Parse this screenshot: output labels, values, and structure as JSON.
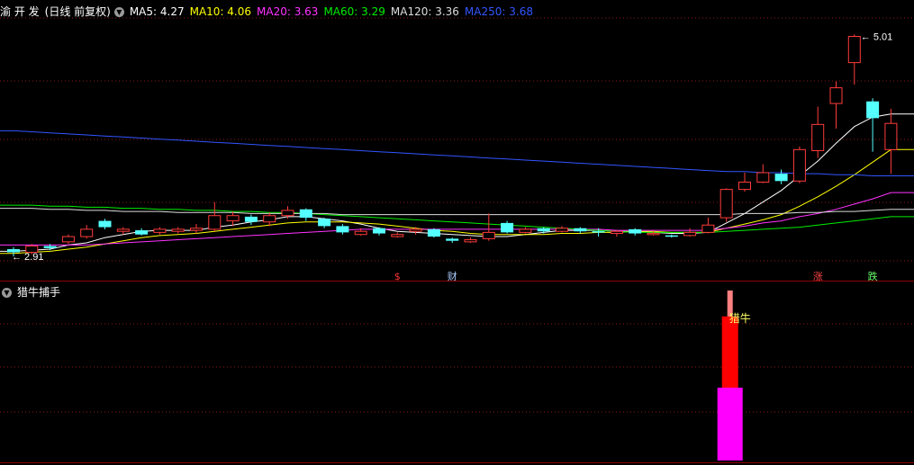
{
  "main_header": {
    "stock_name": "渝 开 发",
    "mode": "(日线 前复权)",
    "ma_labels": [
      {
        "text": "MA5: 4.27",
        "color": "#ffffff"
      },
      {
        "text": "MA10: 4.06",
        "color": "#ffff00"
      },
      {
        "text": "MA20: 3.63",
        "color": "#ff33ff"
      },
      {
        "text": "MA60: 3.29",
        "color": "#00ee00"
      },
      {
        "text": "MA120: 3.36",
        "color": "#dddddd"
      },
      {
        "text": "MA250: 3.68",
        "color": "#3355ff"
      }
    ]
  },
  "indicator_header": {
    "name": "猎牛捕手"
  },
  "colors": {
    "up": "#ff3b3b",
    "down": "#54ffff",
    "grid": "#8b1a1a",
    "separator": "#8b0000"
  },
  "chart_data": [
    {
      "type": "candlestick",
      "ylim": [
        2.8,
        5.1
      ],
      "annotations": {
        "low_label": "2.91",
        "high_label": "5.01",
        "markers": [
          {
            "index": 21,
            "text": "$",
            "color": "#ff3333"
          },
          {
            "index": 24,
            "text": "财",
            "color": "#aaccff"
          },
          {
            "index": 44,
            "text": "涨",
            "color": "#ff4444"
          },
          {
            "index": 47,
            "text": "跌",
            "color": "#66ff66"
          }
        ]
      },
      "candles": [
        [
          2.98,
          2.95,
          3.0,
          2.91
        ],
        [
          2.95,
          3.01,
          3.03,
          2.93
        ],
        [
          3.01,
          2.99,
          3.03,
          2.97
        ],
        [
          3.05,
          3.1,
          3.12,
          3.03
        ],
        [
          3.1,
          3.17,
          3.21,
          3.08
        ],
        [
          3.25,
          3.19,
          3.27,
          3.17
        ],
        [
          3.15,
          3.17,
          3.19,
          3.12
        ],
        [
          3.16,
          3.12,
          3.18,
          3.11
        ],
        [
          3.14,
          3.17,
          3.19,
          3.12
        ],
        [
          3.15,
          3.17,
          3.19,
          3.13
        ],
        [
          3.16,
          3.18,
          3.22,
          3.13
        ],
        [
          3.17,
          3.3,
          3.43,
          3.15
        ],
        [
          3.25,
          3.3,
          3.34,
          3.2
        ],
        [
          3.29,
          3.24,
          3.31,
          3.21
        ],
        [
          3.24,
          3.3,
          3.33,
          3.2
        ],
        [
          3.3,
          3.35,
          3.39,
          3.27
        ],
        [
          3.36,
          3.28,
          3.37,
          3.25
        ],
        [
          3.27,
          3.2,
          3.28,
          3.18
        ],
        [
          3.2,
          3.14,
          3.22,
          3.12
        ],
        [
          3.12,
          3.15,
          3.18,
          3.11
        ],
        [
          3.18,
          3.13,
          3.19,
          3.11
        ],
        [
          3.1,
          3.12,
          3.14,
          3.09
        ],
        [
          3.15,
          3.17,
          3.19,
          3.12
        ],
        [
          3.17,
          3.1,
          3.18,
          3.09
        ],
        [
          3.08,
          3.06,
          3.09,
          3.04
        ],
        [
          3.05,
          3.07,
          3.09,
          3.04
        ],
        [
          3.08,
          3.14,
          3.32,
          3.06
        ],
        [
          3.23,
          3.14,
          3.25,
          3.13
        ],
        [
          3.14,
          3.17,
          3.19,
          3.13
        ],
        [
          3.18,
          3.15,
          3.19,
          3.13
        ],
        [
          3.15,
          3.18,
          3.2,
          3.14
        ],
        [
          3.18,
          3.15,
          3.19,
          3.13
        ],
        [
          3.15,
          3.14,
          3.18,
          3.1
        ],
        [
          3.13,
          3.15,
          3.16,
          3.1
        ],
        [
          3.17,
          3.13,
          3.18,
          3.11
        ],
        [
          3.12,
          3.13,
          3.15,
          3.11
        ],
        [
          3.11,
          3.1,
          3.12,
          3.09
        ],
        [
          3.11,
          3.14,
          3.18,
          3.1
        ],
        [
          3.14,
          3.21,
          3.28,
          3.13
        ],
        [
          3.28,
          3.55,
          3.56,
          3.24
        ],
        [
          3.55,
          3.62,
          3.71,
          3.53
        ],
        [
          3.62,
          3.71,
          3.79,
          3.61
        ],
        [
          3.7,
          3.63,
          3.74,
          3.6
        ],
        [
          3.63,
          3.93,
          3.96,
          3.61
        ],
        [
          3.92,
          4.17,
          4.34,
          3.85
        ],
        [
          4.37,
          4.52,
          4.58,
          4.13
        ],
        [
          4.76,
          5.01,
          5.03,
          4.55
        ],
        [
          4.39,
          4.23,
          4.42,
          3.91
        ],
        [
          3.93,
          4.18,
          4.32,
          3.7
        ]
      ],
      "moving_averages": [
        {
          "name": "MA5",
          "color": "#ffffff",
          "values": [
            2.96,
            2.97,
            2.98,
            3.02,
            3.04,
            3.09,
            3.12,
            3.15,
            3.16,
            3.16,
            3.16,
            3.19,
            3.21,
            3.24,
            3.26,
            3.29,
            3.29,
            3.27,
            3.25,
            3.22,
            3.18,
            3.15,
            3.14,
            3.13,
            3.12,
            3.11,
            3.1,
            3.1,
            3.12,
            3.14,
            3.16,
            3.16,
            3.16,
            3.15,
            3.15,
            3.14,
            3.13,
            3.13,
            3.14,
            3.23,
            3.32,
            3.43,
            3.54,
            3.68,
            3.82,
            3.99,
            4.15,
            4.24,
            4.27
          ]
        },
        {
          "name": "MA10",
          "color": "#ffff00",
          "values": [
            2.94,
            2.95,
            2.96,
            2.98,
            3.0,
            3.03,
            3.06,
            3.09,
            3.11,
            3.12,
            3.13,
            3.15,
            3.17,
            3.19,
            3.21,
            3.23,
            3.24,
            3.24,
            3.24,
            3.23,
            3.22,
            3.2,
            3.18,
            3.16,
            3.15,
            3.13,
            3.12,
            3.12,
            3.12,
            3.12,
            3.13,
            3.13,
            3.14,
            3.14,
            3.15,
            3.15,
            3.14,
            3.14,
            3.14,
            3.18,
            3.22,
            3.26,
            3.31,
            3.39,
            3.48,
            3.58,
            3.69,
            3.81,
            3.93
          ]
        },
        {
          "name": "MA20",
          "color": "#ff33ff",
          "values": [
            3.02,
            3.02,
            3.02,
            3.02,
            3.02,
            3.03,
            3.04,
            3.05,
            3.06,
            3.07,
            3.08,
            3.09,
            3.1,
            3.11,
            3.12,
            3.13,
            3.14,
            3.15,
            3.16,
            3.17,
            3.17,
            3.17,
            3.17,
            3.17,
            3.17,
            3.17,
            3.17,
            3.17,
            3.17,
            3.17,
            3.17,
            3.17,
            3.17,
            3.16,
            3.16,
            3.16,
            3.16,
            3.16,
            3.16,
            3.18,
            3.2,
            3.23,
            3.25,
            3.29,
            3.32,
            3.36,
            3.41,
            3.46,
            3.52
          ]
        },
        {
          "name": "MA60",
          "color": "#00ee00",
          "values": [
            3.4,
            3.4,
            3.39,
            3.39,
            3.38,
            3.38,
            3.37,
            3.37,
            3.36,
            3.36,
            3.35,
            3.35,
            3.34,
            3.34,
            3.33,
            3.33,
            3.32,
            3.31,
            3.3,
            3.29,
            3.28,
            3.27,
            3.26,
            3.25,
            3.24,
            3.23,
            3.22,
            3.21,
            3.2,
            3.19,
            3.18,
            3.17,
            3.16,
            3.15,
            3.14,
            3.14,
            3.14,
            3.14,
            3.14,
            3.15,
            3.16,
            3.17,
            3.18,
            3.19,
            3.21,
            3.23,
            3.25,
            3.27,
            3.29
          ]
        },
        {
          "name": "MA120",
          "color": "#dddddd",
          "values": [
            3.37,
            3.37,
            3.36,
            3.36,
            3.35,
            3.35,
            3.34,
            3.34,
            3.34,
            3.33,
            3.33,
            3.33,
            3.33,
            3.32,
            3.32,
            3.32,
            3.32,
            3.32,
            3.31,
            3.31,
            3.31,
            3.31,
            3.31,
            3.31,
            3.31,
            3.31,
            3.31,
            3.31,
            3.31,
            3.31,
            3.31,
            3.31,
            3.31,
            3.31,
            3.31,
            3.31,
            3.31,
            3.31,
            3.31,
            3.31,
            3.32,
            3.32,
            3.32,
            3.33,
            3.33,
            3.34,
            3.34,
            3.35,
            3.36
          ]
        },
        {
          "name": "MA250",
          "color": "#3355ff",
          "values": [
            4.11,
            4.1,
            4.09,
            4.08,
            4.07,
            4.06,
            4.05,
            4.04,
            4.03,
            4.02,
            4.01,
            4.0,
            3.99,
            3.98,
            3.97,
            3.96,
            3.95,
            3.94,
            3.93,
            3.92,
            3.91,
            3.9,
            3.89,
            3.88,
            3.87,
            3.86,
            3.85,
            3.84,
            3.83,
            3.82,
            3.81,
            3.8,
            3.79,
            3.78,
            3.77,
            3.76,
            3.75,
            3.74,
            3.73,
            3.72,
            3.72,
            3.71,
            3.71,
            3.7,
            3.7,
            3.69,
            3.69,
            3.68,
            3.68
          ]
        }
      ]
    },
    {
      "type": "bar",
      "indicator": "猎牛捕手",
      "label": "猎牛",
      "bar_index": 39,
      "segments": [
        {
          "color": "#ff00ff",
          "value": 0.45
        },
        {
          "color": "#ff0000",
          "value": 0.44
        },
        {
          "color": "#ff8080",
          "value": 0.16
        }
      ]
    }
  ]
}
